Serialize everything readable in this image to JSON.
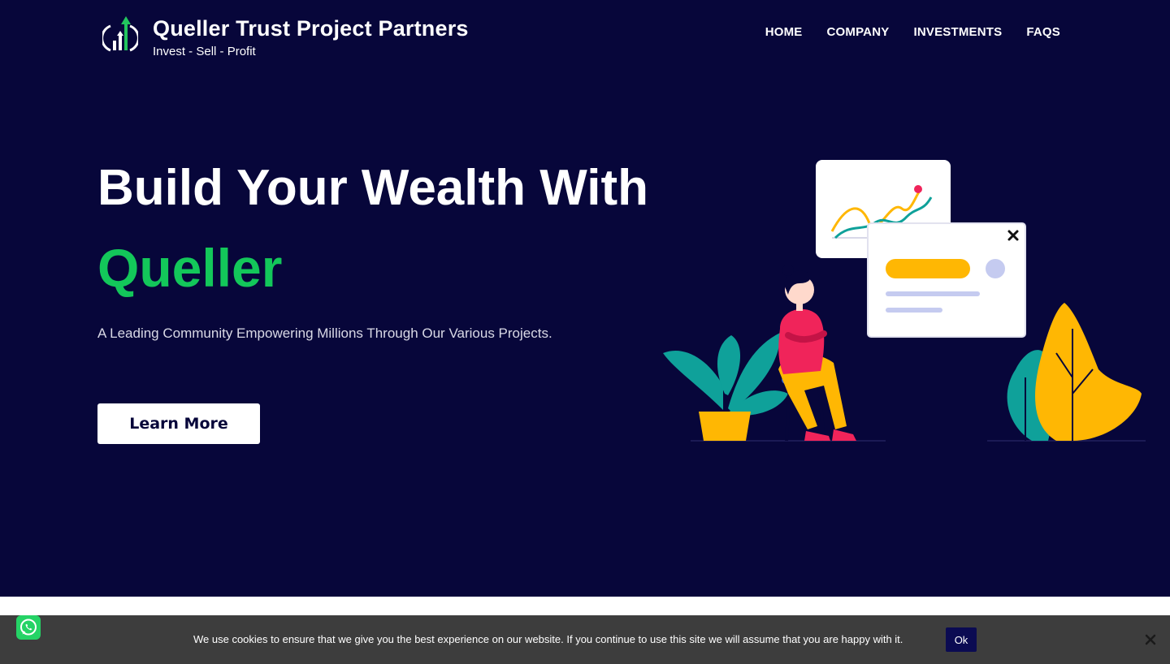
{
  "header": {
    "brand_name": "Queller Trust Project Partners",
    "tagline": "Invest - Sell - Profit",
    "nav": [
      {
        "label": "HOME"
      },
      {
        "label": "COMPANY"
      },
      {
        "label": "INVESTMENTS"
      },
      {
        "label": "FAQS"
      }
    ]
  },
  "hero": {
    "title": "Build Your Wealth With",
    "highlight": "Queller",
    "subtitle": "A Leading Community Empowering Millions Through Our Various Projects.",
    "cta_label": "Learn More"
  },
  "cookie": {
    "text": "We use cookies to ensure that we give you the best experience on our website. If you continue to use this site we will assume that you are happy with it.",
    "ok_label": "Ok"
  },
  "colors": {
    "background": "#07063a",
    "accent_green": "#13c75a",
    "cookie_bar": "#3d3d3d",
    "teal": "#0fa19a",
    "yellow": "#ffb703",
    "pink": "#f0245a"
  },
  "icons": {
    "logo": "growth-arrows-logo-icon",
    "whatsapp": "whatsapp-icon",
    "cookie_close": "close-icon",
    "popup_close": "close-icon"
  }
}
